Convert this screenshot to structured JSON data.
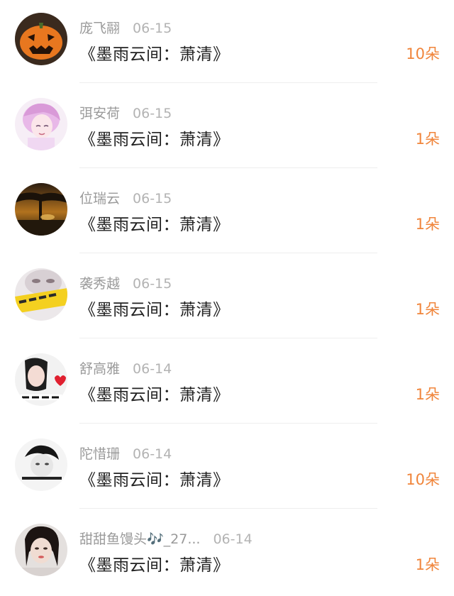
{
  "colors": {
    "accent": "#f0853b",
    "name_text": "#9a9a9a",
    "title_text": "#222222",
    "divider": "#eeeeee"
  },
  "items": [
    {
      "name": "庞飞翮",
      "date": "06-15",
      "title": "《墨雨云间：萧清》",
      "count": "10朵",
      "avatar": "pumpkin-avatar"
    },
    {
      "name": "弭安荷",
      "date": "06-15",
      "title": "《墨雨云间：萧清》",
      "count": "1朵",
      "avatar": "anime-girl-avatar"
    },
    {
      "name": "位瑞云",
      "date": "06-15",
      "title": "《墨雨云间：萧清》",
      "count": "1朵",
      "avatar": "sunset-tree-avatar"
    },
    {
      "name": "袭秀越",
      "date": "06-15",
      "title": "《墨雨云间：萧清》",
      "count": "1朵",
      "avatar": "girl-text-avatar"
    },
    {
      "name": "舒高雅",
      "date": "06-14",
      "title": "《墨雨云间：萧清》",
      "count": "1朵",
      "avatar": "girl-heart-avatar"
    },
    {
      "name": "陀惜珊",
      "date": "06-14",
      "title": "《墨雨云间：萧清》",
      "count": "10朵",
      "avatar": "bw-boy-avatar"
    },
    {
      "name": "甜甜鱼馒头🎶_27...",
      "date": "06-14",
      "title": "《墨雨云间：萧清》",
      "count": "1朵",
      "avatar": "girl-portrait-avatar"
    }
  ]
}
